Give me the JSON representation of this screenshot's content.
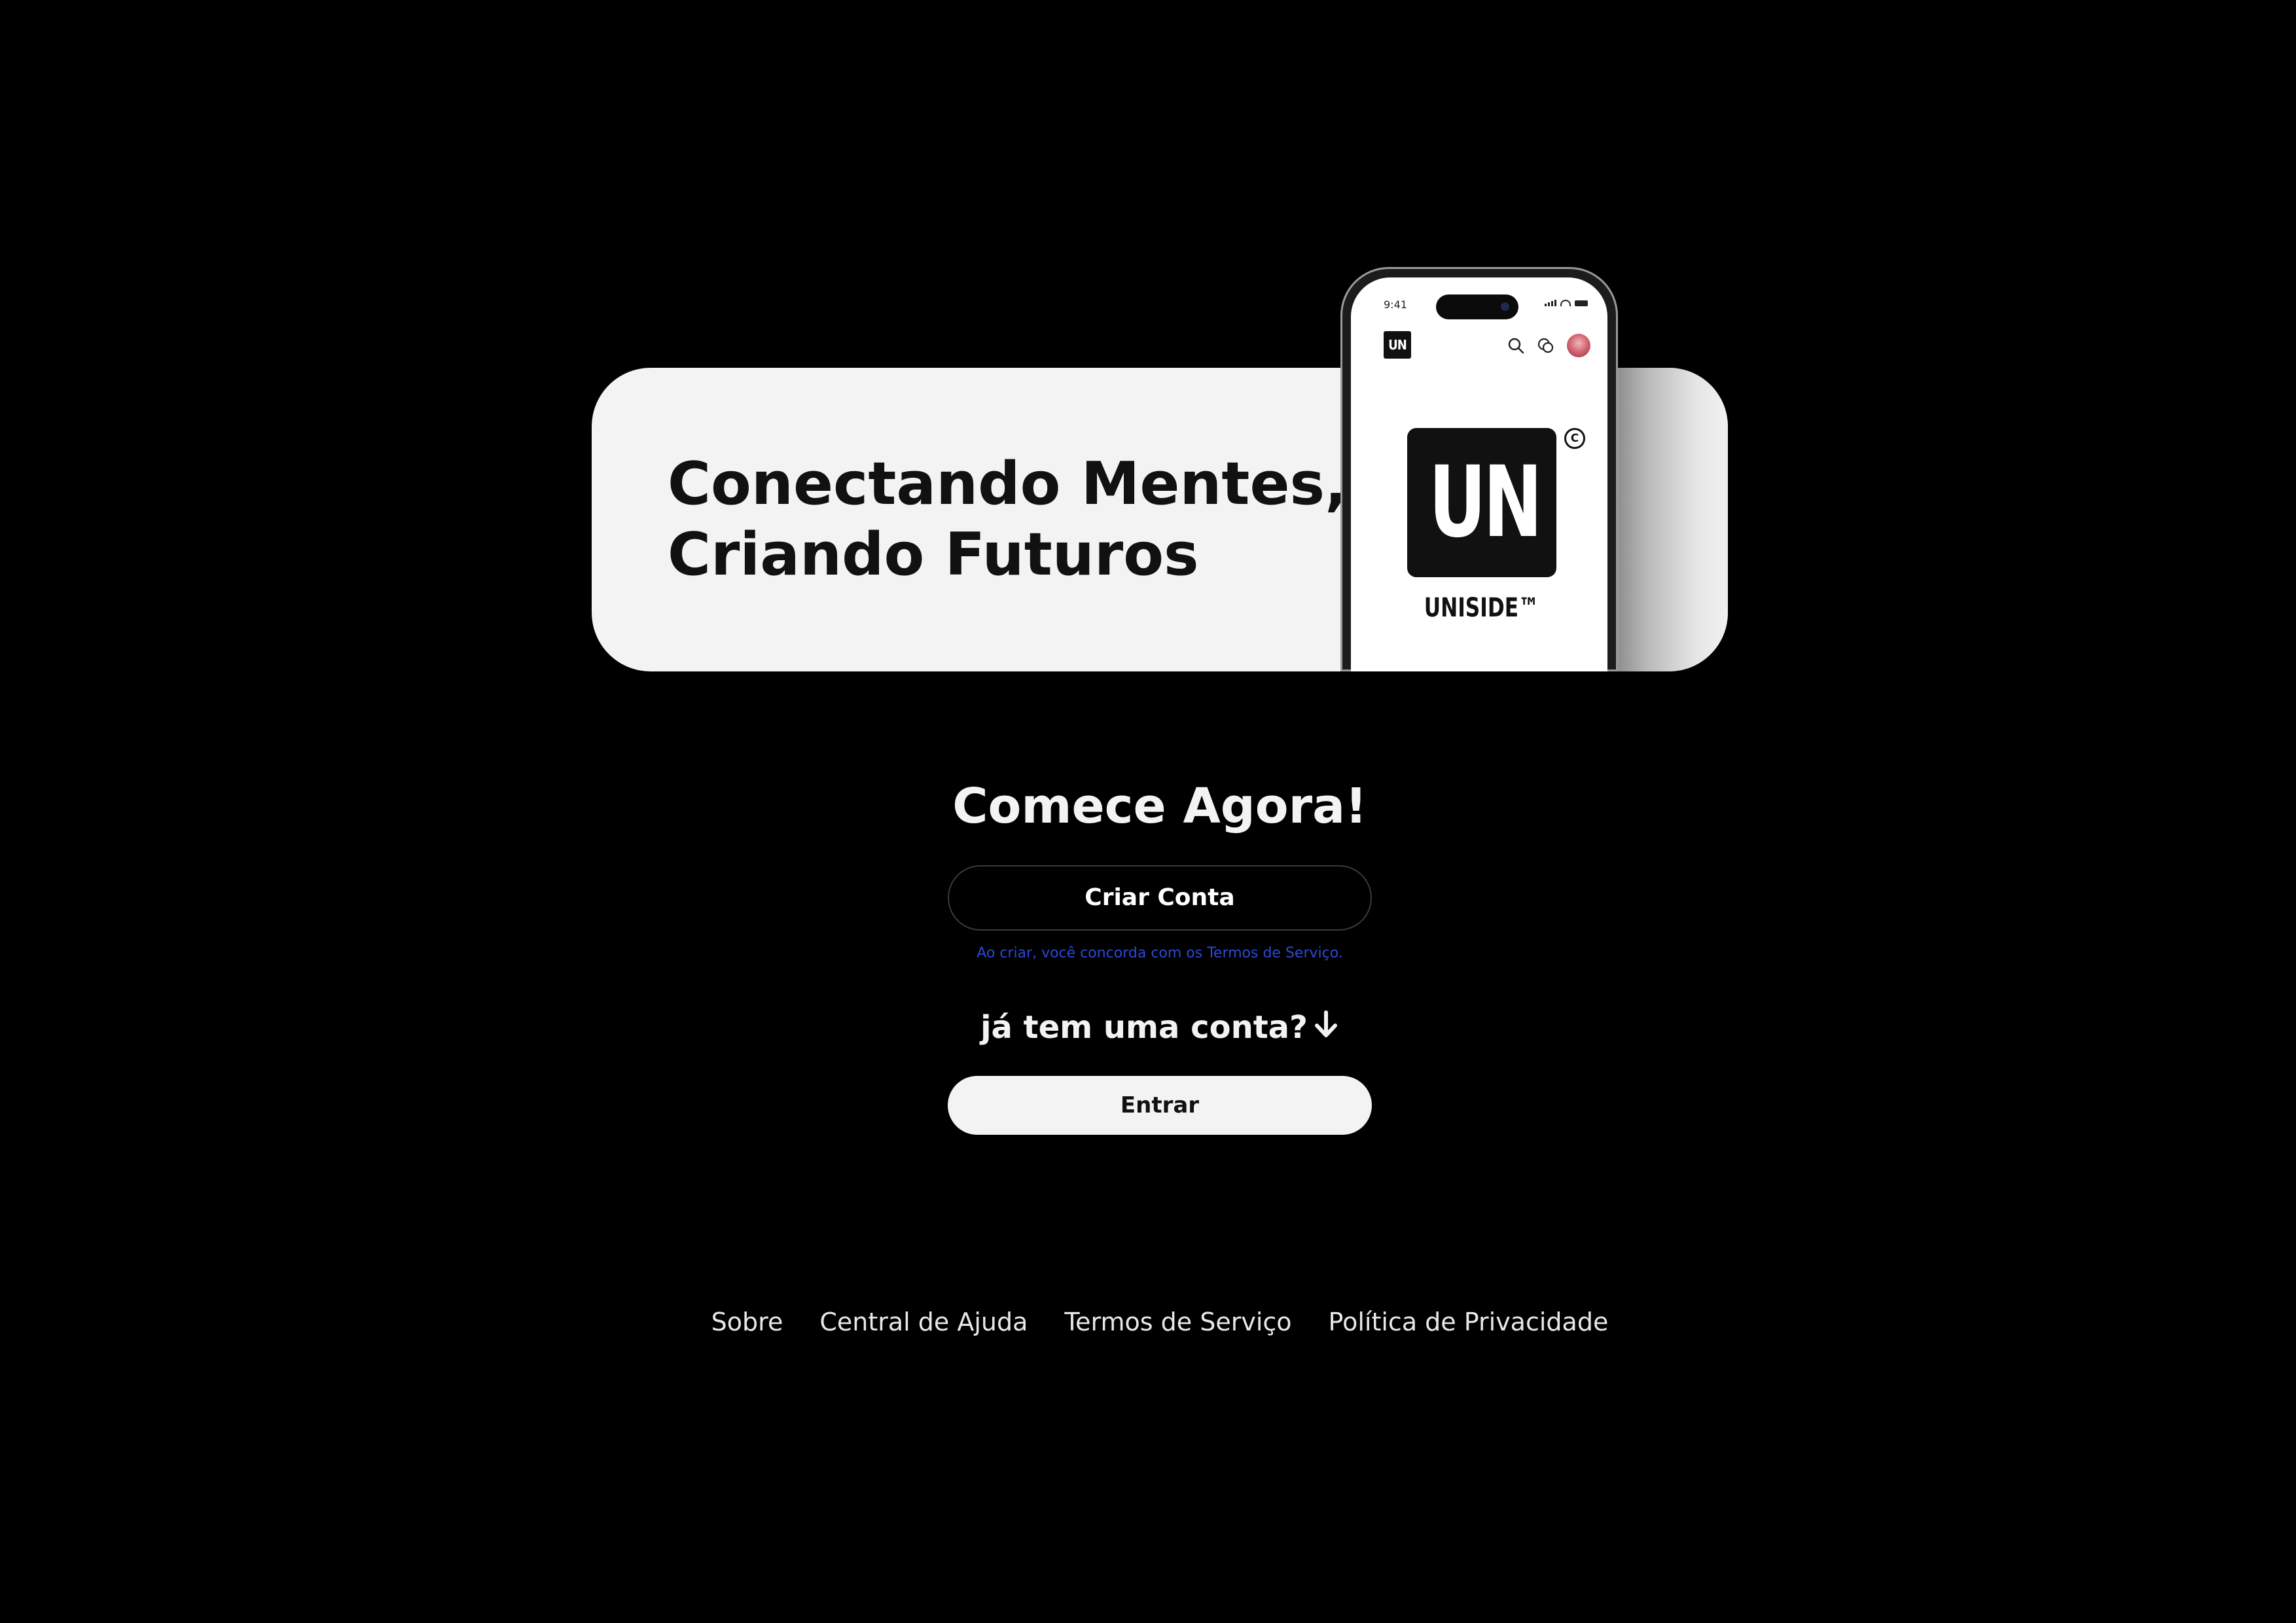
{
  "hero": {
    "title_line1": "Conectando Mentes,",
    "title_line2": "Criando Futuros"
  },
  "phone": {
    "time": "9:41",
    "app_logo": "UN",
    "big_logo": "UN",
    "copyright_symbol": "C",
    "brand_name": "UNISIDE™",
    "icons": [
      "search-icon",
      "chat-icon",
      "avatar"
    ]
  },
  "cta": {
    "title": "Comece Agora!",
    "create_label": "Criar Conta",
    "terms_note": "Ao criar, você concorda com os Termos de Serviço.",
    "have_account": "já tem uma conta?",
    "login_label": "Entrar"
  },
  "footer": {
    "links": [
      "Sobre",
      "Central de Ajuda",
      "Termos de Serviço",
      "Política de Privacidade"
    ]
  },
  "colors": {
    "background": "#000000",
    "card": "#f3f3f3",
    "text_dark": "#111111",
    "text_light": "#f3f3f3",
    "terms_link": "#2a49d6"
  }
}
